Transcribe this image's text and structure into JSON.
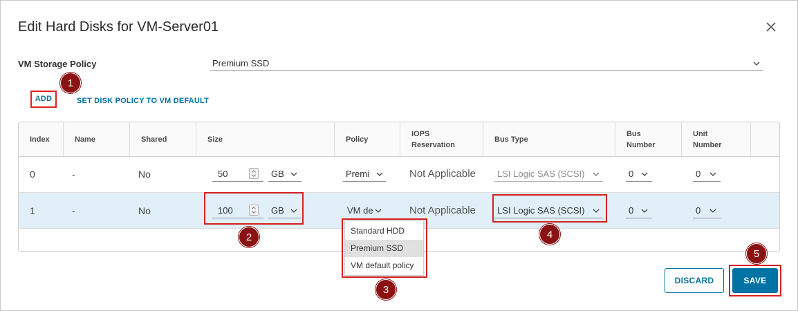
{
  "dialog": {
    "title": "Edit Hard Disks for VM-Server01"
  },
  "storage_policy": {
    "label": "VM Storage Policy",
    "value": "Premium SSD"
  },
  "actions": {
    "add_label": "ADD",
    "set_default_label": "SET DISK POLICY TO VM DEFAULT"
  },
  "table": {
    "headers": {
      "index": "Index",
      "name": "Name",
      "shared": "Shared",
      "size": "Size",
      "policy": "Policy",
      "iops": "IOPS Reservation",
      "bus_type": "Bus Type",
      "bus_number": "Bus Number",
      "unit_number": "Unit Number"
    },
    "rows": [
      {
        "index": "0",
        "name": "-",
        "shared": "No",
        "size": "50",
        "unit": "GB",
        "policy": "Premi",
        "iops": "Not Applicable",
        "bus_type": "LSI Logic SAS (SCSI)",
        "bus_number": "0",
        "unit_number": "0"
      },
      {
        "index": "1",
        "name": "-",
        "shared": "No",
        "size": "100",
        "unit": "GB",
        "policy": "VM de",
        "iops": "Not Applicable",
        "bus_type": "LSI Logic SAS (SCSI)",
        "bus_number": "0",
        "unit_number": "0"
      }
    ]
  },
  "policy_dropdown": {
    "options": [
      "Standard HDD",
      "Premium SSD",
      "VM default policy"
    ],
    "highlighted": "Premium SSD"
  },
  "callouts": [
    "1",
    "2",
    "3",
    "4",
    "5"
  ],
  "footer": {
    "discard_label": "DISCARD",
    "save_label": "SAVE"
  },
  "colors": {
    "accent": "#0072a3",
    "callout_red": "#d42020",
    "badge": "#8a1212",
    "selected_row": "#e1f0f8"
  }
}
